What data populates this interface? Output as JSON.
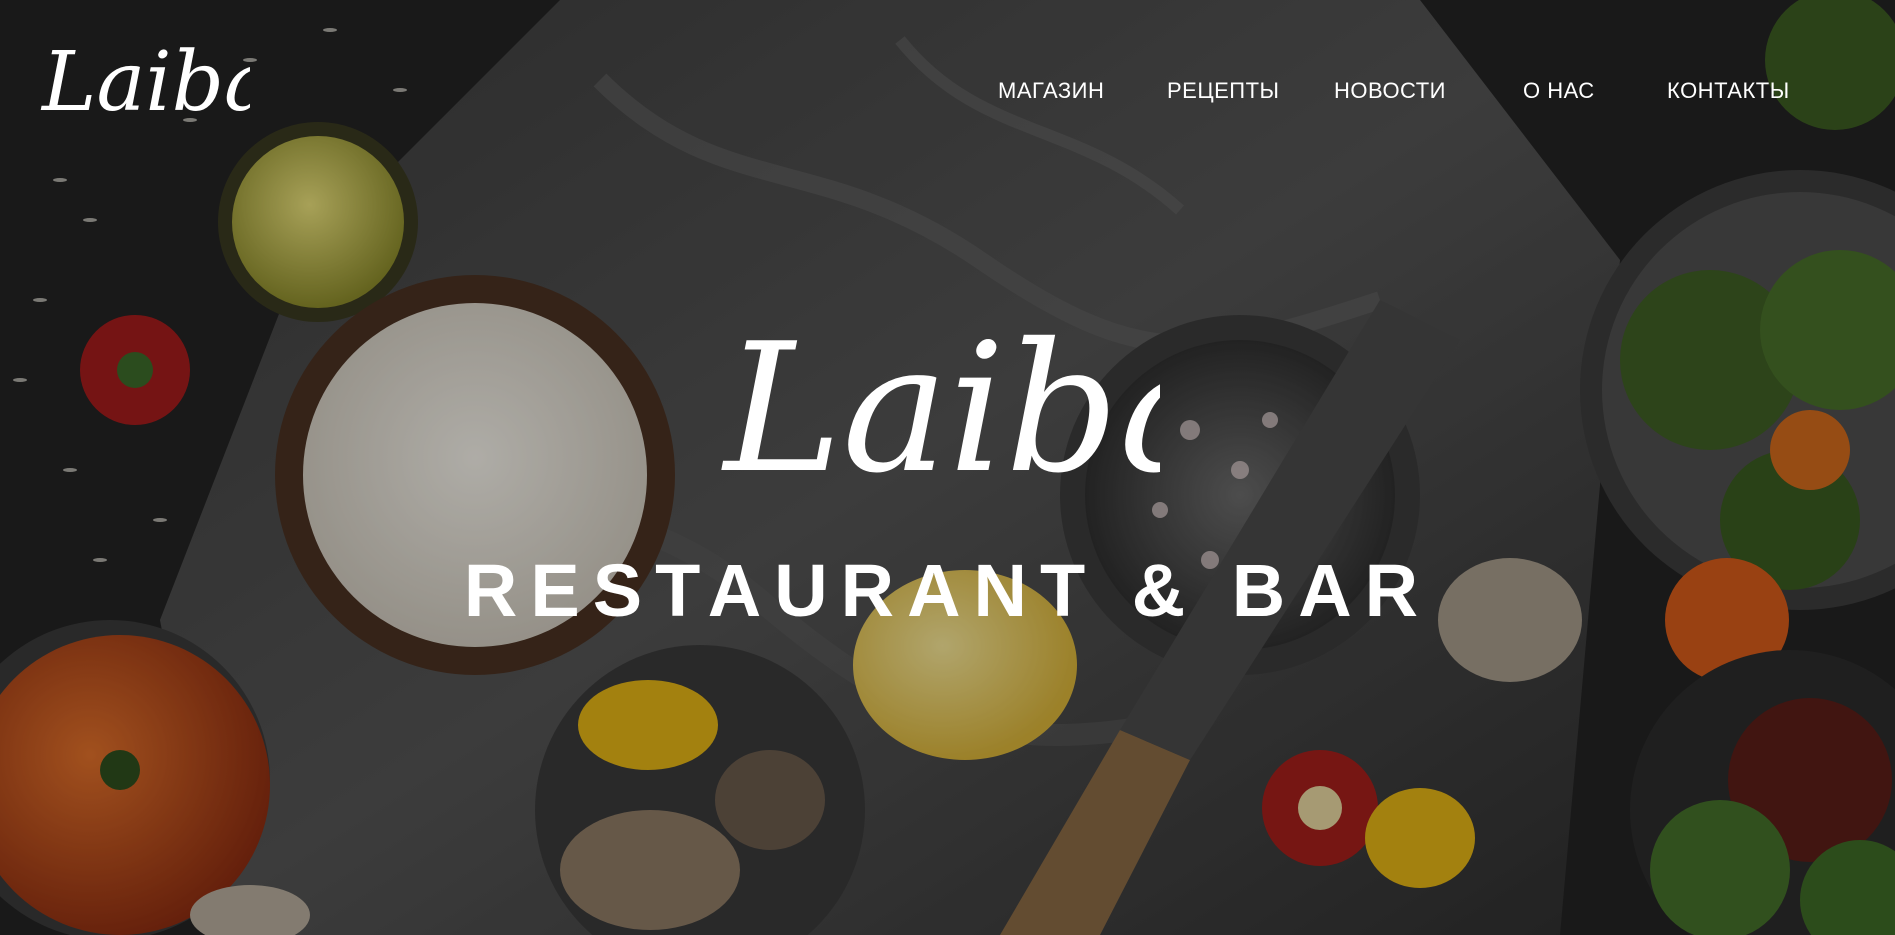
{
  "brand": {
    "logo_text": "Laibas"
  },
  "nav": {
    "items": [
      {
        "label": "МАГАЗИН"
      },
      {
        "label": "РЕЦЕПТЫ"
      },
      {
        "label": "НОВОСТИ"
      },
      {
        "label": "О НАС"
      },
      {
        "label": "КОНТАКТЫ"
      }
    ]
  },
  "hero": {
    "logo_text": "Laibas",
    "tagline": "RESTAURANT & BAR"
  }
}
